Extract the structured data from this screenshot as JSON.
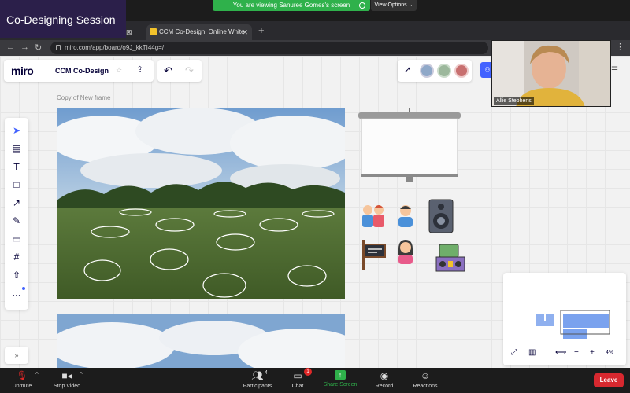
{
  "zoom": {
    "session_label": "Co-Designing Session",
    "viewing_banner": "You are viewing Sanuree Gomes's screen",
    "view_options": "View Options",
    "video_name": "Allie Stephens",
    "bottom": {
      "unmute": "Unmute",
      "stop_video": "Stop Video",
      "participants": "Participants",
      "participants_count": "4",
      "chat": "Chat",
      "chat_badge": "1",
      "share_screen": "Share Screen",
      "record": "Record",
      "reactions": "Reactions",
      "leave": "Leave"
    }
  },
  "browser": {
    "tab_title": "CCM Co-Design, Online White",
    "url": "miro.com/app/board/o9J_kkTI44g=/"
  },
  "miro": {
    "logo": "miro",
    "board_title": "CCM Co-Design",
    "frame_label": "Copy of New frame",
    "zoom_level": "4%"
  },
  "colors": {
    "miro_blue": "#4262ff",
    "zoom_green": "#2fb14b",
    "leave_red": "#d7282f"
  }
}
